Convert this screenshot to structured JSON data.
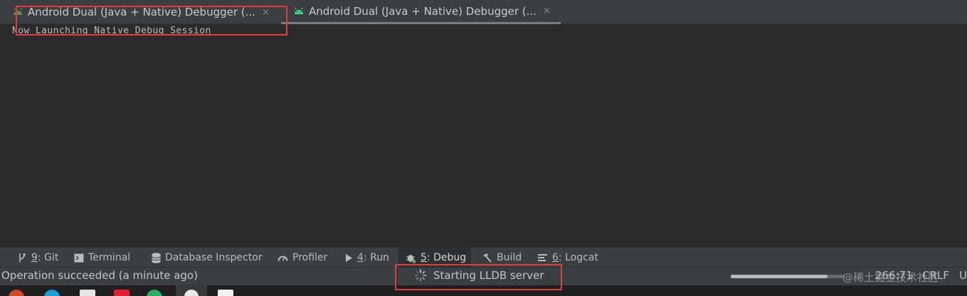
{
  "editor_tabs": [
    {
      "label": "Android Dual (Java + Native) Debugger (...",
      "close": "×"
    },
    {
      "label": "Android Dual (Java + Native) Debugger (...",
      "close": "×"
    }
  ],
  "console": {
    "line": "Now Launching Native Debug Session"
  },
  "tool_windows": [
    {
      "key": "9",
      "label": ": Git",
      "icon": "git-branch-icon"
    },
    {
      "key": "",
      "label": "Terminal",
      "icon": "terminal-icon"
    },
    {
      "key": "",
      "label": "Database Inspector",
      "icon": "database-icon"
    },
    {
      "key": "",
      "label": "Profiler",
      "icon": "profiler-gauge-icon"
    },
    {
      "key": "4",
      "label": ": Run",
      "icon": "run-triangle-icon"
    },
    {
      "key": "5",
      "label": ": Debug",
      "icon": "bug-icon"
    },
    {
      "key": "",
      "label": "Build",
      "icon": "hammer-icon"
    },
    {
      "key": "6",
      "label": ": Logcat",
      "icon": "logcat-list-icon"
    }
  ],
  "status_bar": {
    "message": "Operation succeeded (a minute ago)",
    "task": "Starting LLDB server",
    "progress": 0.85,
    "position": "266:71",
    "line_separator": "CRLF",
    "encoding": "U",
    "watermark": "@稀土掘金技术社区"
  },
  "colors": {
    "android_green": "#3ddc84",
    "highlight_red": "#e03e3e",
    "debug_active_dot": "#59a869"
  }
}
